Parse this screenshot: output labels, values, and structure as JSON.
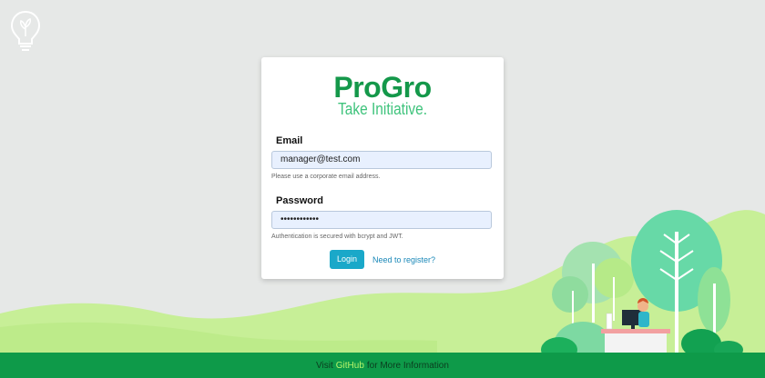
{
  "brand": {
    "title": "ProGro",
    "tagline": "Take Initiative."
  },
  "form": {
    "email_label": "Email",
    "email_value": "manager@test.com",
    "email_hint": "Please use a corporate email address.",
    "password_label": "Password",
    "password_value": "••••••••••••",
    "password_hint": "Authentication is secured with bcrypt and JWT.",
    "login_label": "Login",
    "register_label": "Need to register?"
  },
  "footer": {
    "prefix": "Visit",
    "link": "GitHub",
    "suffix": "for More Information"
  },
  "icons": {
    "top_left": "lightbulb-icon"
  },
  "colors": {
    "brand_green": "#14984a",
    "tagline_green": "#3fc37c",
    "footer_bg": "#0e9a49",
    "button_bg": "#1aa8c9",
    "background": "#e6e8e7"
  }
}
